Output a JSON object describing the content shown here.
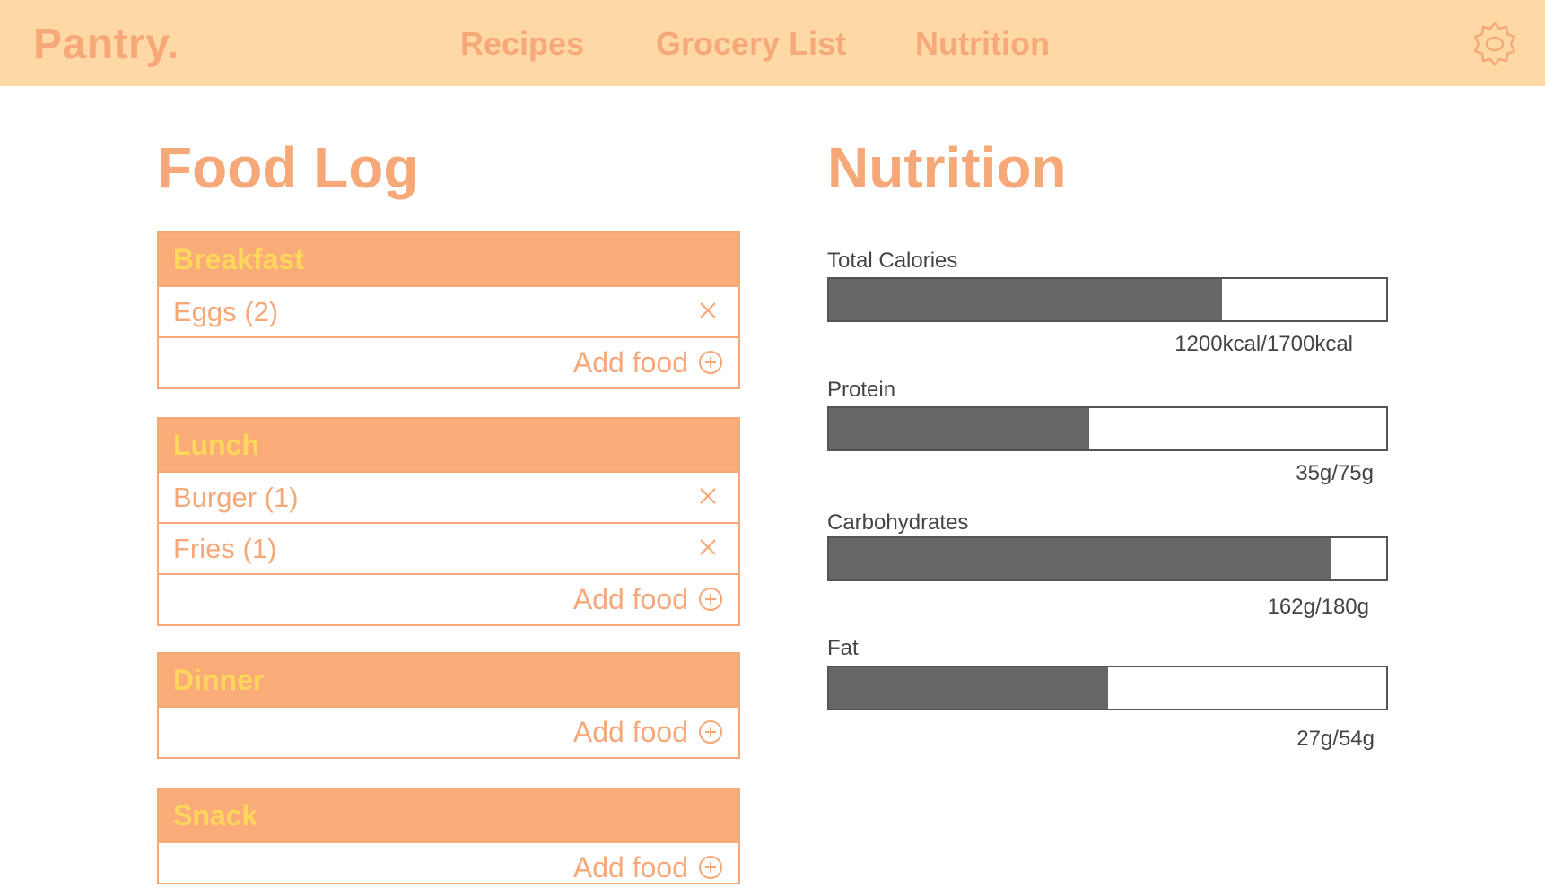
{
  "app": {
    "brand": "Pantry."
  },
  "nav": {
    "items": [
      "Recipes",
      "Grocery List",
      "Nutrition"
    ]
  },
  "icons": {
    "settings": "gear-icon",
    "remove": "close-icon",
    "add": "plus-circle-icon"
  },
  "colors": {
    "header_bg": "#FED9A6",
    "accent": "#F6A878",
    "meal_header_bg": "#F9AB78",
    "meal_header_text": "#FFD85B",
    "bar_fill": "#666666"
  },
  "food_log": {
    "title": "Food Log",
    "meals": [
      {
        "name": "Breakfast",
        "foods": [
          "Eggs (2)"
        ],
        "add_label": "Add food"
      },
      {
        "name": "Lunch",
        "foods": [
          "Burger (1)",
          "Fries (1)"
        ],
        "add_label": "Add food"
      },
      {
        "name": "Dinner",
        "foods": [],
        "add_label": "Add food"
      },
      {
        "name": "Snack",
        "foods": [],
        "add_label": "Add food"
      }
    ]
  },
  "nutrition": {
    "title": "Nutrition",
    "stats": [
      {
        "label": "Total Calories",
        "value_text": "1200kcal/1700kcal",
        "current": 1200,
        "goal": 1700
      },
      {
        "label": "Protein",
        "value_text": "35g/75g",
        "current": 35,
        "goal": 75
      },
      {
        "label": "Carbohydrates",
        "value_text": "162g/180g",
        "current": 162,
        "goal": 180
      },
      {
        "label": "Fat",
        "value_text": "27g/54g",
        "current": 27,
        "goal": 54
      }
    ]
  }
}
